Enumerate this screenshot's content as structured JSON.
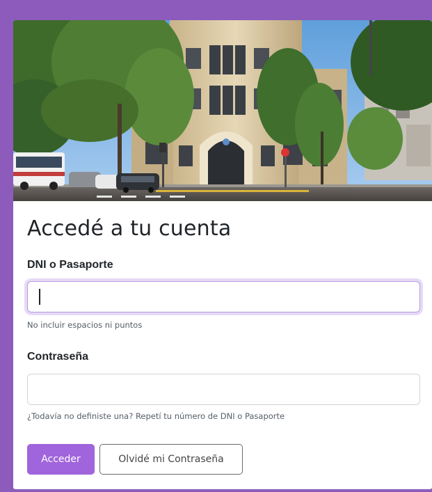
{
  "page": {
    "title": "Accedé a tu cuenta"
  },
  "form": {
    "dni": {
      "label": "DNI o Pasaporte",
      "value": "",
      "help": "No incluir espacios ni puntos"
    },
    "password": {
      "label": "Contraseña",
      "value": "",
      "help": "¿Todavía no definiste una? Repetí tu número de DNI o Pasaporte"
    }
  },
  "buttons": {
    "submit": "Acceder",
    "forgot": "Olvidé mi Contraseña"
  },
  "colors": {
    "page_background": "#8c5bbb",
    "primary": "#a064dc",
    "focus_ring": "#e6daf6"
  }
}
